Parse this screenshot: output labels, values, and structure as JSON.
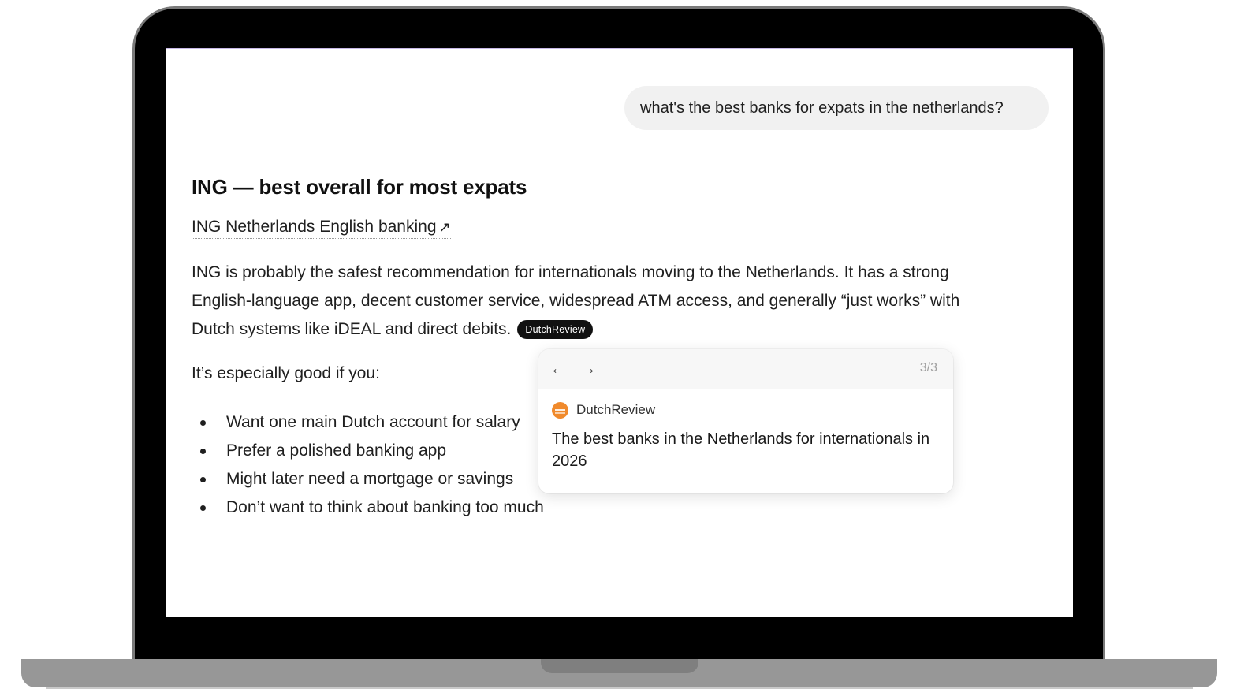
{
  "chat": {
    "user_message": "what's the best banks for expats in the netherlands?"
  },
  "answer": {
    "heading": "ING — best overall for most expats",
    "source_link": "ING Netherlands English banking",
    "paragraph_lines": [
      "ING is probably the safest recommendation for internationals moving to the Netherlands. It has a strong",
      "English-language app, decent customer service, widespread ATM access, and generally “just works” with",
      "Dutch systems like iDEAL and direct debits."
    ],
    "citation_chip": "DutchReview",
    "intro": "It’s especially good if you:",
    "bullets": [
      "Want one main Dutch account for salary",
      "Prefer a polished banking app",
      "Might later need a mortgage or savings",
      "Don’t want to think about banking too much"
    ]
  },
  "popover": {
    "pager": "3/3",
    "source_name": "DutchReview",
    "article_title": "The best banks in the Netherlands for internationals in 2026",
    "favicon_color": "#f08a2c"
  }
}
